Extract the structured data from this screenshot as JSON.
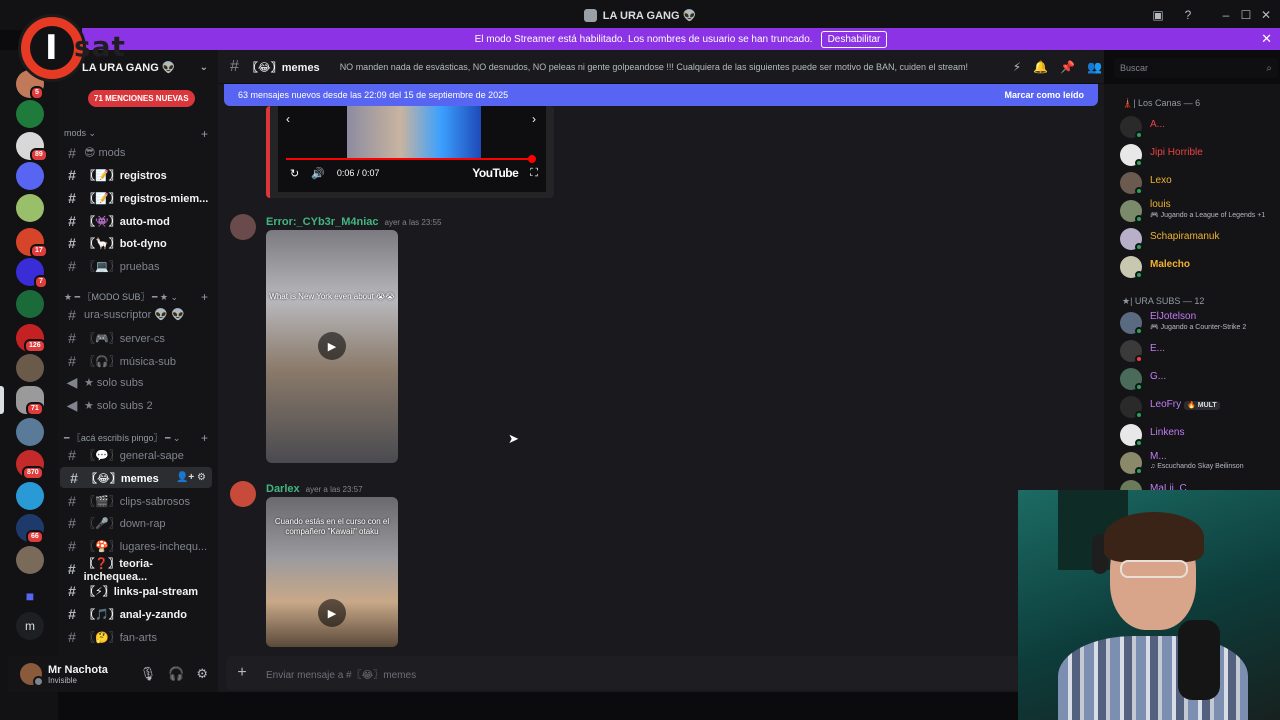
{
  "window": {
    "title": "LA URA GANG 👽"
  },
  "banner": {
    "text": "El modo Streamer está habilitado. Los nombres de usuario se han truncado.",
    "button": "Deshabilitar"
  },
  "logo": {
    "text": "sat",
    "letter": "I"
  },
  "rail": {
    "badges": [
      "5",
      "89",
      "17",
      "7",
      "126",
      "71",
      "870",
      "66"
    ],
    "bottom_letter": "m"
  },
  "server": {
    "name": "LA URA GANG 👽",
    "mentions": "71 MENCIONES NUEVAS"
  },
  "sidebar": {
    "categories": [
      {
        "label": "mods ⌄"
      },
      {
        "label": "★ ━ 〖MODO SUB〗 ━ ★ ⌄"
      },
      {
        "label": "━ 〖acá escribís pingo〗 ━ ⌄"
      }
    ],
    "channels": [
      {
        "label": "😎 mods"
      },
      {
        "label": "〖📝〗registros"
      },
      {
        "label": "〖📝〗registros-miem..."
      },
      {
        "label": "〖👾〗auto-mod"
      },
      {
        "label": "〖🦙〗bot-dyno"
      },
      {
        "label": "〖💻〗pruebas"
      },
      {
        "label": "ura-suscriptor 👽 👽"
      },
      {
        "label": "〖🎮〗server-cs"
      },
      {
        "label": "〖🎧〗música-sub"
      },
      {
        "label": "★ solo subs"
      },
      {
        "label": "★ solo subs 2"
      },
      {
        "label": "〖💬〗general-sape"
      },
      {
        "label": "〖😂〗memes"
      },
      {
        "label": "〖🎬〗clips-sabrosos"
      },
      {
        "label": "〖🎤〗down-rap"
      },
      {
        "label": "〖🍄〗lugares-inchequ..."
      },
      {
        "label": "〖❓〗teoria-inchequea..."
      },
      {
        "label": "〖⚡〗links-pal-stream"
      },
      {
        "label": "〖🎵〗anal-y-zando"
      },
      {
        "label": "〖🤔〗fan-arts"
      }
    ]
  },
  "user": {
    "name": "Mr Nachota",
    "status": "Invisible"
  },
  "channel": {
    "name": "〖😂〗memes",
    "topic": "NO manden nada de esvásticas, NO desnudos, NO peleas ni gente golpeandose !!! Cualquiera de las siguientes puede ser motivo de BAN, cuiden el stream!"
  },
  "newbar": {
    "text": "63 mensajes nuevos desde las 22:09 del 15 de septiembre de 2025",
    "action": "Marcar como leído"
  },
  "player": {
    "time": "0:06 / 0:07",
    "brand": "YouTube"
  },
  "messages": [
    {
      "author": "Error:_CYb3r_M4niac",
      "timestamp": "ayer a las 23:55",
      "video_caption": "What is New York even about 😭😭",
      "author_color": "#43b581"
    },
    {
      "author": "Darlex",
      "timestamp": "ayer a las 23:57",
      "video_caption": "Cuando estás en el curso con el compañero \"Kawaii\" otaku",
      "author_color": "#43b581"
    }
  ],
  "composer": {
    "placeholder": "Enviar mensaje a #〖😂〗memes"
  },
  "search": {
    "placeholder": "Buscar"
  },
  "members": {
    "groups": [
      {
        "label": "🗼| Los Canas — 6"
      },
      {
        "label": "★| URA SUBS — 12"
      }
    ],
    "list": [
      {
        "name": "A...",
        "color": "#ed4245",
        "activity": ""
      },
      {
        "name": "Jipi Horrible",
        "color": "#ed4245",
        "activity": ""
      },
      {
        "name": "Lexo",
        "color": "#f0b232",
        "activity": ""
      },
      {
        "name": "louis",
        "color": "#f0b232",
        "activity": "🎮 Jugando a League of Legends +1"
      },
      {
        "name": "Schapiramanuk",
        "color": "#f0b232",
        "activity": ""
      },
      {
        "name": "Malecho",
        "color": "#f0b232",
        "activity": ""
      },
      {
        "name": "ElJotelson",
        "color": "#c27cf5",
        "activity": "🎮 Jugando a Counter-Strike 2"
      },
      {
        "name": "E...",
        "color": "#c27cf5",
        "activity": ""
      },
      {
        "name": "G...",
        "color": "#c27cf5",
        "activity": ""
      },
      {
        "name": "LeoFry",
        "color": "#c27cf5",
        "activity": "",
        "tag": "🔥 MULT"
      },
      {
        "name": "Linkens",
        "color": "#c27cf5",
        "activity": ""
      },
      {
        "name": "M...",
        "color": "#c27cf5",
        "activity": "♫ Escuchando Skay Beilinson"
      },
      {
        "name": "MaLii..C",
        "color": "#c27cf5",
        "activity": ""
      }
    ]
  },
  "colors": {
    "accent": "#5865f2",
    "banner": "#8c33e6",
    "mention_red": "#da373c"
  }
}
